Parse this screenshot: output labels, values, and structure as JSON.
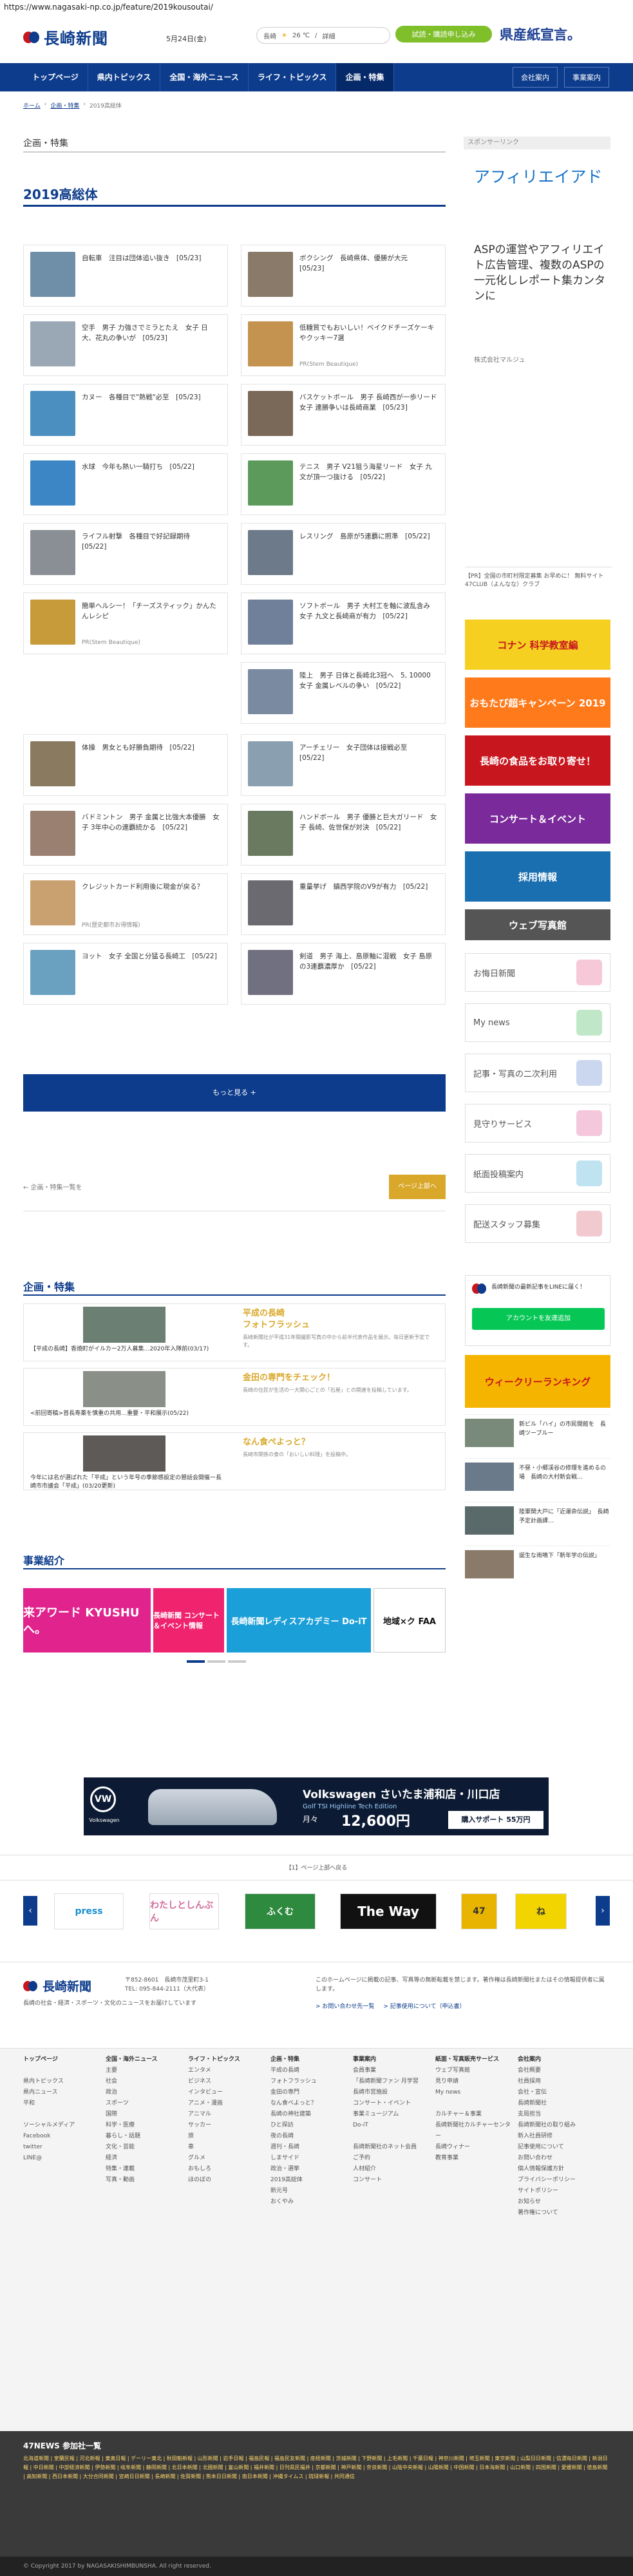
{
  "browser": {
    "url": "https://www.nagasaki-np.co.jp/feature/2019kousoutai/"
  },
  "header": {
    "logo_text": "長崎新聞",
    "date": "5月24日(金)",
    "weather": {
      "city": "長崎",
      "temp": "26 ℃",
      "sep": "/",
      "detail": "詳細"
    },
    "subscribe_label": "試読・購読申し込み",
    "banner_text": "県産紙宣言。"
  },
  "nav": {
    "items": [
      "トップページ",
      "県内トピックス",
      "全国・海外ニュース",
      "ライフ・トピックス",
      "企画・特集"
    ],
    "right": [
      "会社案内",
      "事業案内"
    ]
  },
  "breadcrumb": [
    "ホーム",
    "企画・特集",
    "2019高総体"
  ],
  "section_label": "企画・特集",
  "page_title": "2019高総体",
  "articles": [
    {
      "title": "自転車　注目は団体追い抜き　[05/23]",
      "source": "",
      "color": "#6f8fa8"
    },
    {
      "title": "ボクシング　長崎県体、優勝が大元　[05/23]",
      "source": "",
      "color": "#8a7a6a"
    },
    {
      "title": "空手　男子 力強さでミラとたえ　女子 日大、花丸の争いが　[05/23]",
      "source": "",
      "color": "#9aa8b5"
    },
    {
      "title": "低糖質でもおいしい！ベイクドチーズケーキやクッキー7選",
      "source": "PR(Stem Beautique)",
      "color": "#c4934f"
    },
    {
      "title": "カヌー　各種目で\"熱戦\"必至　[05/23]",
      "source": "",
      "color": "#4a8fc0"
    },
    {
      "title": "バスケットボール　男子 長崎西が一歩リード　女子 連勝争いは長崎商業　[05/23]",
      "source": "",
      "color": "#7a6858"
    },
    {
      "title": "水球　今年も熱い一騎打ち　[05/22]",
      "source": "",
      "color": "#3d86c6"
    },
    {
      "title": "テニス　男子 V21狙う海星リード　女子 九文が頂一つ抜ける　[05/22]",
      "source": "",
      "color": "#5b9a5a"
    },
    {
      "title": "ライフル射撃　各種目で好記録期待　[05/22]",
      "source": "",
      "color": "#8a8f95"
    },
    {
      "title": "レスリング　島原が5連覇に照準　[05/22]",
      "source": "",
      "color": "#6c7a8a"
    },
    {
      "title": "簡単ヘルシー！「チーズスティック」かんたんレシピ",
      "source": "PR(Stem Beautique)",
      "color": "#c79a3a"
    },
    {
      "title": "ソフトボール　男子 大村工を軸に波乱含み　女子 九文と長崎商が有力　[05/22]",
      "source": "",
      "color": "#70809a"
    },
    {
      "title": "",
      "source": "",
      "color": "#ffffff"
    },
    {
      "title": "陸上　男子 日体と長崎北3冠へ　5, 10000 女子 金属レベルの争い　[05/22]",
      "source": "",
      "color": "#7a8aa0"
    },
    {
      "title": "体操　男女とも好勝負期待　[05/22]",
      "source": "",
      "color": "#8a7a60"
    },
    {
      "title": "アーチェリー　女子団体は接戦必至　[05/22]",
      "source": "",
      "color": "#8aa0b0"
    },
    {
      "title": "バドミントン　男子 金属と比強大本優勝　女子 3年中心の連覇続かる　[05/22]",
      "source": "",
      "color": "#9a8070"
    },
    {
      "title": "ハンドボール　男子 優勝と巨大ガリード　女子 長崎、佐世保が対決　[05/22]",
      "source": "",
      "color": "#6a7a60"
    },
    {
      "title": "クレジットカード利用後に現金が戻る？",
      "source": "PR(歴史都市お得情報)",
      "color": "#c9a070"
    },
    {
      "title": "重量挙げ　鎮西学院のV9が有力　[05/22]",
      "source": "",
      "color": "#6a6a70"
    },
    {
      "title": "ヨット　女子 全国と分猛る長崎工　[05/22]",
      "source": "",
      "color": "#6aa0c0"
    },
    {
      "title": "剣道　男子 海上、島原軸に混戦　女子 島原の3連覇濃厚か　[05/22]",
      "source": "",
      "color": "#707080"
    }
  ],
  "more_label": "もっと見る +",
  "list_link": "← 企画・特集一覧を",
  "to_top": "ページ上部へ",
  "features": {
    "heading": "企画・特集",
    "items": [
      {
        "caption": "【平成の長崎】香焼町がイルカー2万人募集…2020年入隊前(03/17)",
        "title_l1": "平成の長崎",
        "title_l2": "フォトフラッシュ",
        "desc": "長崎新聞社が平成31年間撮影写真の中から前半代表作品を展示。毎日更新予定です。"
      },
      {
        "caption": "<前回寄稿>首長寿薬を慎重の共用…重要・平和展示(05/22)",
        "title_l1": "",
        "title_l2": "金田の専門をチェック！",
        "desc": "長崎の住民が生活の一大関心ごとの「石屋」との関連を投稿しています。"
      },
      {
        "caption": "今年には名が選ばれた「平成」という年号の季節感設定の懇話会開催ー長崎市市議会「平成」(03/20更新)",
        "title_l1": "",
        "title_l2": "なん食ぺよっと？",
        "desc": "長崎市関係の食の「おいしい料理」を投稿中。"
      }
    ]
  },
  "business": {
    "heading": "事業紹介",
    "slides": [
      "来アワード KYUSHUへ。",
      "長崎新聞 コンサート＆イベント情報",
      "長崎新聞レディスアカデミー Do-iT",
      "地域×ク FAA"
    ]
  },
  "ad": {
    "brand": "Volkswagen",
    "title": "Volkswagen さいたま浦和店・川口店",
    "model": "Golf TSI Highline Tech Edition",
    "monthly_label": "月々",
    "price": "12,600円",
    "cta": "購入サポート 55万円"
  },
  "pager": "【1】ページ上部へ戻る",
  "logo_slides": [
    "press",
    "わたしとしんぶん",
    "ふくむ",
    "The Way",
    "47",
    "ね"
  ],
  "footer": {
    "address": "〒852-8601　長崎市茂里町3-1",
    "tel": "TEL: 095-844-2111（大代表）",
    "desc": "長崎の社会・経済・スポーツ・文化のニュースをお届けしています",
    "legal": "このホームページに掲載の記事、写真等の無断転載を禁じます。著作権は長崎新聞社またはその情報提供者に属します。",
    "link1": "> お問い合わせ先一覧",
    "link2": "> 記事使用について（申込書）",
    "sitemap": [
      {
        "title": "トップページ",
        "items": [
          "",
          "県内トピックス",
          "県内ニュース",
          "平和",
          "",
          "ソーシャルメディア",
          "Facebook",
          "twitter",
          "LINE@"
        ]
      },
      {
        "title": "全国・海外ニュース",
        "items": [
          "主要",
          "社会",
          "政治",
          "スポーツ",
          "国際",
          "科学・医療",
          "暮らし・話題",
          "文化・芸能",
          "経済",
          "特集・連載",
          "写真・動画"
        ]
      },
      {
        "title": "ライフ・トピックス",
        "items": [
          "エンタメ",
          "ビジネス",
          "インタビュー",
          "アニメ・漫画",
          "アニマル",
          "サッカー",
          "旅",
          "車",
          "グルメ",
          "おもしろ",
          "ほのぼの"
        ]
      },
      {
        "title": "企画・特集",
        "items": [
          "平成の長崎",
          "フォトフラッシュ",
          "金田の専門",
          "なん食べよっと？",
          "長崎の神社建築",
          "ひと探訪",
          "夜の長崎",
          "週刊・長崎",
          "しまサイド",
          "政治・選挙",
          "2019高総体",
          "新元号",
          "おくやみ"
        ]
      },
      {
        "title": "事業案内",
        "items": [
          "会員事業",
          "「長崎新聞ファン 月学習",
          "長崎市営施設",
          "コンサート・イベント",
          "事業ミュージアム",
          "Do-iT",
          "",
          "長崎新聞社のネット会員",
          "ご予約",
          "人材紹介",
          "コンサート"
        ]
      },
      {
        "title": "紙面・写真販売サービス",
        "items": [
          "ウェブ写真館",
          "見り申請",
          "My news",
          "",
          "カルチャー＆事業",
          "長崎新聞社カルチャーセンター",
          "長崎ウィナー",
          "教育事業"
        ]
      },
      {
        "title": "会社案内",
        "items": [
          "会社概要",
          "社員採用",
          "会社・宣伝",
          "長崎新聞社",
          "支局担当",
          "長崎新聞社の取り組み",
          "新入社員研修",
          "記事使用について",
          "お問い合わせ",
          "個人情報保護方針",
          "プライバシーポリシー",
          "サイトポリシー",
          "お知らせ",
          "著作権について"
        ]
      }
    ],
    "f47_heading": "47NEWS 参加社一覧",
    "f47_links": "北海道新聞 | 室蘭民報 | 河北新報 | 東奥日報 | デーリー東北 | 秋田魁新報 | 山形新聞 | 岩手日報 | 福島民報 | 福島民友新聞 | 産経新聞 | 茨城新聞 | 下野新聞 | 上毛新聞 | 千葉日報 | 神奈川新聞 | 埼玉新聞 | 東京新聞 | 山梨日日新聞 | 信濃毎日新聞 | 新潟日報 | 中日新聞 | 中部経済新聞 | 伊勢新聞 | 岐阜新聞 | 静岡新聞 | 北日本新聞 | 北國新聞 | 富山新聞 | 福井新聞 | 日刊県民福井 | 京都新聞 | 神戸新聞 | 奈良新聞 | 山陰中央新報 | 山陽新聞 | 中国新聞 | 日本海新聞 | 山口新聞 | 四国新聞 | 愛媛新聞 | 徳島新聞 | 高知新聞 | 西日本新聞 | 大分合同新聞 | 宮崎日日新聞 | 長崎新聞 | 佐賀新聞 | 熊本日日新聞 | 南日本新聞 | 沖縄タイムス | 琉球新報 | 共同通信",
    "copyright": "© Copyright 2017 by NAGASAKISHIMBUNSHA. All right reserved."
  },
  "sidebar": {
    "sponsor_label": "スポンサーリンク",
    "ad_title": "アフィリエイアド",
    "ad_desc": "ASPの運営やアフィリエイト広告管理、複数のASPの一元化しレポート集カンタンに",
    "advertiser": "株式会社マルジュ",
    "note": "【PR】全国の市町村限定募集 お早めに！ 無料サイト 47CLUB（よんなな）クラブ",
    "banners": [
      "コナン 科学教室編",
      "おもたび超キャンペーン 2019",
      "長崎の食品をお取り寄せ！",
      "コンサート＆イベント",
      "採用情報",
      "ウェブ写真館"
    ],
    "buttons": [
      "お悔日新聞",
      "My news",
      "記事・写真の二次利用",
      "見守りサービス",
      "紙面投稿案内",
      "配送スタッフ募集"
    ],
    "line_text": "長崎新聞の最新記事をLINEに届く！",
    "line_button": "アカウントを友達追加",
    "ranking_banner": "ウィークリーランキング",
    "side_items": [
      "新ビル「ハイ」の市民開館を　長崎ツーブルー",
      "不昼・小郷渓谷の修理を進めるの場　長崎の大村新会戦…",
      "陸軍関大戸に「近運命伝説」　長崎予定計画課…",
      "誕生な雨鳴下「新年学の伝説」"
    ]
  }
}
